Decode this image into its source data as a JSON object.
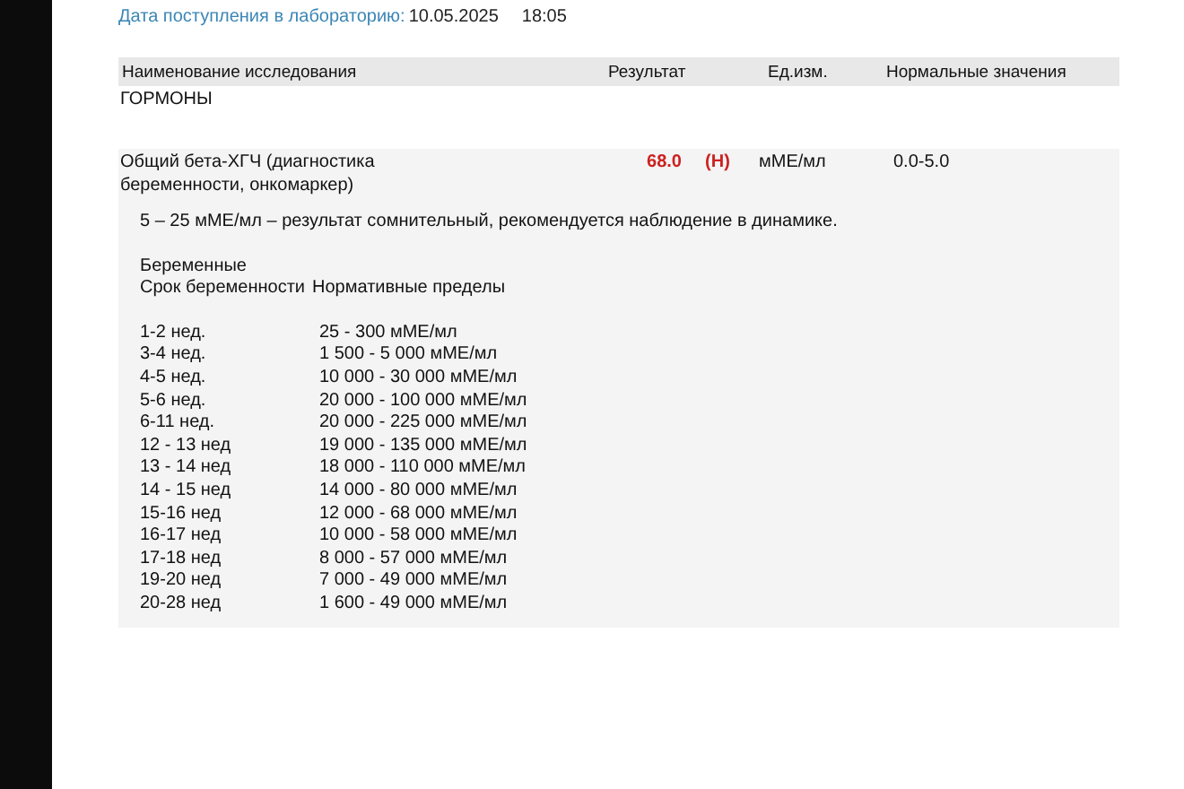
{
  "received": {
    "label": "Дата поступления в лабораторию:",
    "date": "10.05.2025",
    "time": "18:05"
  },
  "columns": [
    "Наименование исследования",
    "Результат",
    "Ед.изм.",
    "Нормальные значения"
  ],
  "section": "ГОРМОНЫ",
  "test": {
    "name": "Общий бета-ХГЧ (диагностика беременности, онкомаркер)",
    "value": "68.0",
    "flag": "(H)",
    "abnormal": true,
    "unit": "мМЕ/мл",
    "normal": "0.0-5.0"
  },
  "comment": {
    "note": "5 – 25 мМЕ/мл – результат сомнительный, рекомендуется наблюдение в динамике.",
    "group": "Беременные",
    "header": [
      "Срок беременности",
      "Нормативные пределы"
    ],
    "rows": [
      {
        "term": "1-2 нед.",
        "range": "25 - 300 мМЕ/мл"
      },
      {
        "term": "3-4 нед.",
        "range": "1 500 - 5 000 мМЕ/мл"
      },
      {
        "term": "4-5 нед.",
        "range": "10 000 - 30 000 мМЕ/мл"
      },
      {
        "term": "5-6 нед.",
        "range": "20 000 - 100 000 мМЕ/мл"
      },
      {
        "term": "6-11 нед.",
        "range": "20 000 - 225 000 мМЕ/мл"
      },
      {
        "term": "12 - 13 нед",
        "range": "19 000 - 135 000 мМЕ/мл"
      },
      {
        "term": "13 - 14 нед",
        "range": "18 000 - 110 000 мМЕ/мл"
      },
      {
        "term": "14 - 15 нед",
        "range": "14 000 - 80 000 мМЕ/мл"
      },
      {
        "term": "15-16 нед",
        "range": "12 000 - 68 000 мМЕ/мл"
      },
      {
        "term": "16-17 нед",
        "range": "10 000 - 58 000 мМЕ/мл"
      },
      {
        "term": "17-18 нед",
        "range": "8 000 - 57 000 мМЕ/мл"
      },
      {
        "term": "19-20 нед",
        "range": "7 000 - 49 000 мМЕ/мл"
      },
      {
        "term": "20-28 нед",
        "range": "1 600 - 49 000 мМЕ/мл"
      }
    ]
  }
}
